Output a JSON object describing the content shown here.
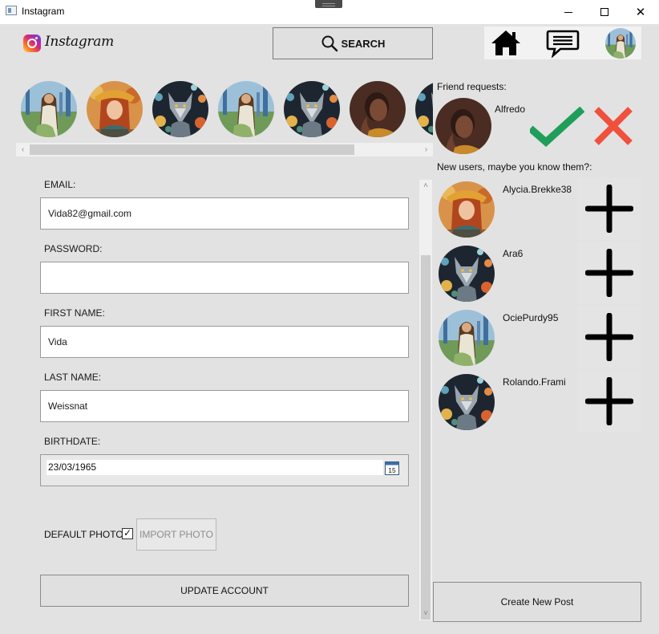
{
  "window": {
    "title": "Instagram",
    "controls": {
      "minimize": "—",
      "close": "✕"
    }
  },
  "header": {
    "logo_text": "Instagram",
    "search_label": "SEARCH",
    "icons": [
      "search-icon",
      "home-icon",
      "chat-icon",
      "profile-avatar"
    ]
  },
  "stories": [
    "woman-field",
    "woman-autumn",
    "wolf-art",
    "woman-field",
    "wolf-art",
    "woman-portrait",
    "wolf-art"
  ],
  "form": {
    "email_label": "EMAIL:",
    "email_value": "Vida82@gmail.com",
    "password_label": "PASSWORD:",
    "password_value": "",
    "first_name_label": "FIRST NAME:",
    "first_name_value": "Vida",
    "last_name_label": "LAST NAME:",
    "last_name_value": "Weissnat",
    "birthdate_label": "BIRTHDATE:",
    "birthdate_value": "23/03/1965",
    "calendar_day": "15",
    "default_photo_label": "DEFAULT PHOTO:",
    "default_photo_checked": true,
    "checkmark": "✓",
    "import_photo_label": "IMPORT PHOTO",
    "update_label": "UPDATE ACCOUNT"
  },
  "friend_requests": {
    "label": "Friend requests:",
    "items": [
      {
        "name": "Alfredo",
        "avatar": "woman-portrait"
      }
    ]
  },
  "suggestions": {
    "label": "New users, maybe you know them?:",
    "items": [
      {
        "name": "Alycia.Brekke38",
        "avatar": "woman-autumn"
      },
      {
        "name": "Ara6",
        "avatar": "wolf-art"
      },
      {
        "name": "OciePurdy95",
        "avatar": "woman-field"
      },
      {
        "name": "Rolando.Frami",
        "avatar": "wolf-art"
      }
    ]
  },
  "create_post_label": "Create New Post",
  "colors": {
    "accept": "#1f9e5a",
    "decline": "#f0503c",
    "background": "#e2e2e2"
  }
}
